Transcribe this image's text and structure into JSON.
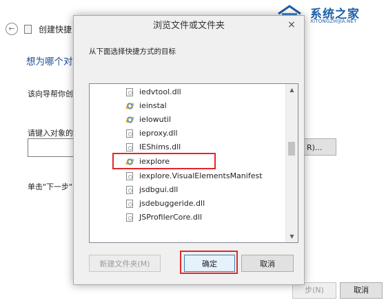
{
  "wizard": {
    "title": "创建快捷",
    "heading": "想为哪个对",
    "description": "该向导帮你创",
    "prompt": "请键入对象的",
    "browse_label": "R)...",
    "hint": "单击\"下一步\"",
    "next_label": "步(N)",
    "cancel_label": "取消"
  },
  "logo": {
    "text": "系统之家",
    "subtext": "XITONGZHIJIA.NET",
    "color": "#1d5fa8"
  },
  "dialog": {
    "title": "浏览文件或文件夹",
    "close_glyph": "×",
    "instruction": "从下面选择快捷方式的目标",
    "items": [
      {
        "label": "iedvtool.dll",
        "icon": "dll-file-icon"
      },
      {
        "label": "ieinstal",
        "icon": "ie-icon"
      },
      {
        "label": "ielowutil",
        "icon": "ie-icon"
      },
      {
        "label": "ieproxy.dll",
        "icon": "dll-file-icon"
      },
      {
        "label": "IEShims.dll",
        "icon": "dll-file-icon"
      },
      {
        "label": "iexplore",
        "icon": "ie-icon"
      },
      {
        "label": "iexplore.VisualElementsManifest",
        "icon": "dll-file-icon"
      },
      {
        "label": "jsdbgui.dll",
        "icon": "dll-file-icon"
      },
      {
        "label": "jsdebuggeride.dll",
        "icon": "dll-file-icon"
      },
      {
        "label": "JSProfilerCore.dll",
        "icon": "dll-file-icon"
      }
    ],
    "new_folder_label": "新建文件夹(M)",
    "ok_label": "确定",
    "cancel_label": "取消"
  },
  "colors": {
    "highlight": "#e2262b",
    "heading_blue": "#1e4e95"
  }
}
